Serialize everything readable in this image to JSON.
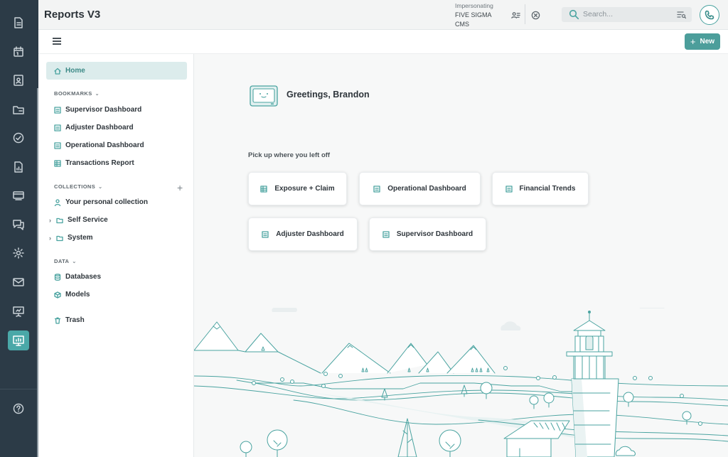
{
  "app": {
    "title": "Reports V3"
  },
  "header": {
    "impersonating_label": "Impersonating",
    "impersonating_org": "FIVE SIGMA",
    "impersonating_role": "CMS",
    "search_placeholder": "Search..."
  },
  "toolbar": {
    "new_label": "New"
  },
  "rail": {
    "items": [
      "document-icon",
      "calendar-icon",
      "contacts-icon",
      "folder-icon",
      "check-circle-icon",
      "file-chart-icon",
      "billing-icon",
      "chat-icon",
      "settings-icon",
      "mail-icon",
      "presentation-icon",
      "reports-icon",
      "help-icon"
    ],
    "active": "reports-icon"
  },
  "sidebar": {
    "home": "Home",
    "bookmarks_title": "BOOKMARKS",
    "bookmarks": [
      "Supervisor Dashboard",
      "Adjuster Dashboard",
      "Operational Dashboard",
      "Transactions Report"
    ],
    "collections_title": "COLLECTIONS",
    "collections": [
      "Your personal collection",
      "Self Service",
      "System"
    ],
    "data_title": "DATA",
    "data": [
      "Databases",
      "Models"
    ],
    "trash": "Trash"
  },
  "main": {
    "greeting": "Greetings, Brandon",
    "pickup_title": "Pick up where you left off",
    "recent": [
      "Exposure + Claim",
      "Operational Dashboard",
      "Financial Trends",
      "Adjuster Dashboard",
      "Supervisor Dashboard"
    ]
  },
  "colors": {
    "accent": "#4c9e9b",
    "rail": "#2c3b47",
    "home_highlight": "#dcecec"
  }
}
